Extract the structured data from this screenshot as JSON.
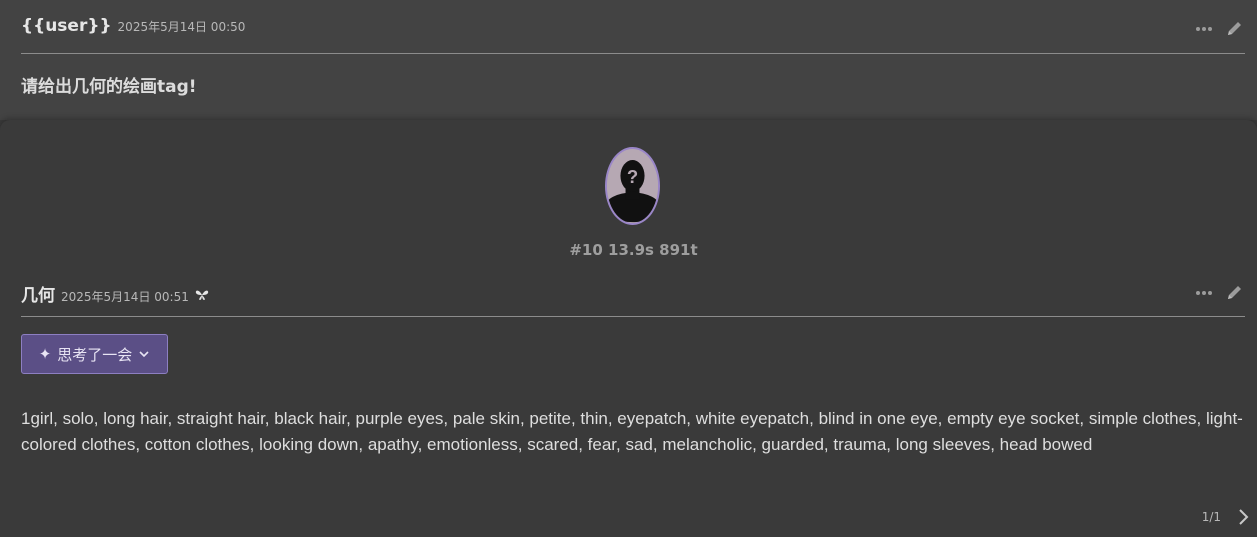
{
  "user_message": {
    "author": "{{user}}",
    "timestamp": "2025年5月14日 00:50",
    "text": "请给出几何的绘画tag!",
    "tools": [
      "more-options-icon",
      "edit-pencil-icon"
    ]
  },
  "char_message": {
    "avatar_icon": "unknown-person-silhouette",
    "stats": "#10 13.9s 891t",
    "author": "几何",
    "timestamp": "2025年5月14日 00:51",
    "model_icon": "butterfly-icon",
    "tools": [
      "more-options-icon",
      "edit-pencil-icon"
    ],
    "thinking_button": {
      "icon": "sparkle-icon",
      "label": "思考了一会",
      "chevron": "chevron-down-icon"
    },
    "text": "1girl, solo, long hair, straight hair, black hair, purple eyes, pale skin, petite, thin, eyepatch, white eyepatch, blind in one eye, empty eye socket, simple clothes, light-colored clothes, cotton clothes, looking down, apathy, emotionless, scared, fear, sad, melancholic, guarded, trauma, long sleeves, head bowed",
    "pager": {
      "label": "1/1",
      "next_icon": "chevron-right-icon"
    }
  },
  "colors": {
    "page_background": "#3a3a3a",
    "user_message_background": "#434343",
    "accent_button": "#5b4f86",
    "avatar_ring": "#9a86c8"
  }
}
